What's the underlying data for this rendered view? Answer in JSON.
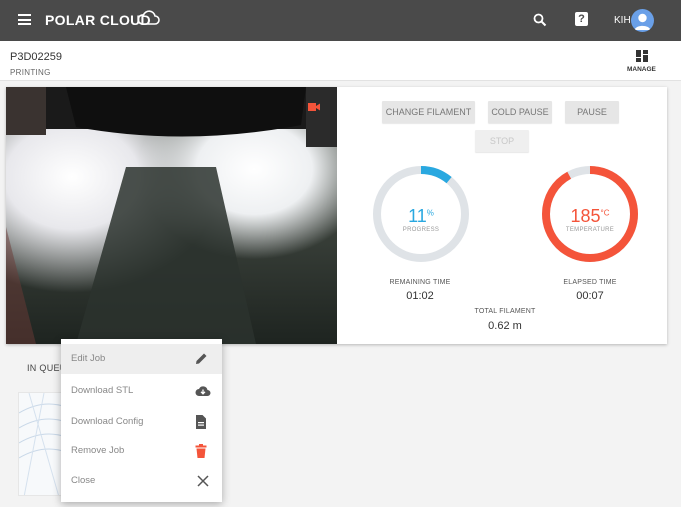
{
  "app": {
    "brand": "POLAR CLOUD",
    "user_initials": "KIH"
  },
  "printer": {
    "name": "P3D02259",
    "status": "PRINTING",
    "manage_label": "MANAGE"
  },
  "controls": {
    "change_filament": "CHANGE FILAMENT",
    "cold_pause": "COLD PAUSE",
    "pause": "PAUSE",
    "stop": "STOP"
  },
  "progress": {
    "value": "11",
    "unit": "%",
    "label": "PROGRESS",
    "fraction": 0.11,
    "color": "#29a8e0"
  },
  "temperature": {
    "value": "185",
    "unit": "°C",
    "label": "TEMPERATURE",
    "fraction": 0.92,
    "color": "#f4543a"
  },
  "stats": {
    "remaining_label": "REMAINING TIME",
    "remaining_value": "01:02",
    "elapsed_label": "ELAPSED TIME",
    "elapsed_value": "00:07",
    "filament_label": "TOTAL FILAMENT",
    "filament_value": "0.62 m"
  },
  "queue": {
    "label": "IN QUEUE"
  },
  "context_menu": {
    "items": [
      {
        "label": "Edit Job",
        "icon": "pencil-icon"
      },
      {
        "label": "Download STL",
        "icon": "cloud-download-icon"
      },
      {
        "label": "Download Config",
        "icon": "document-icon"
      },
      {
        "label": "Remove Job",
        "icon": "trash-icon"
      },
      {
        "label": "Close",
        "icon": "close-icon"
      }
    ]
  }
}
